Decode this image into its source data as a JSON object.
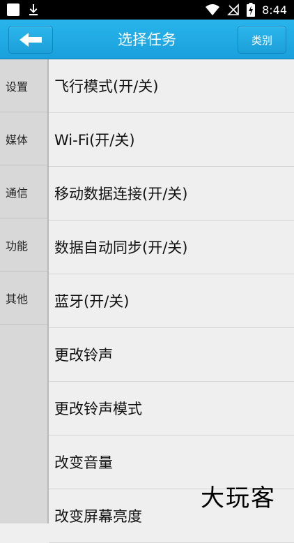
{
  "status_bar": {
    "time": "8:44",
    "icons": [
      "notification-square-icon",
      "download-icon",
      "wifi-icon",
      "no-signal-icon",
      "battery-charging-icon"
    ]
  },
  "header": {
    "back_icon": "arrow-left-icon",
    "title": "选择任务",
    "category_label": "类别"
  },
  "sidebar": {
    "items": [
      "设置",
      "媒体",
      "通信",
      "功能",
      "其他"
    ]
  },
  "tasks": [
    "飞行模式(开/关)",
    "Wi-Fi(开/关)",
    "移动数据连接(开/关)",
    "数据自动同步(开/关)",
    "蓝牙(开/关)",
    "更改铃声",
    "更改铃声模式",
    "改变音量",
    "改变屏幕亮度"
  ],
  "watermark": "大玩客",
  "colors": {
    "accent": "#1ea6e0",
    "status_bar": "#000000"
  }
}
